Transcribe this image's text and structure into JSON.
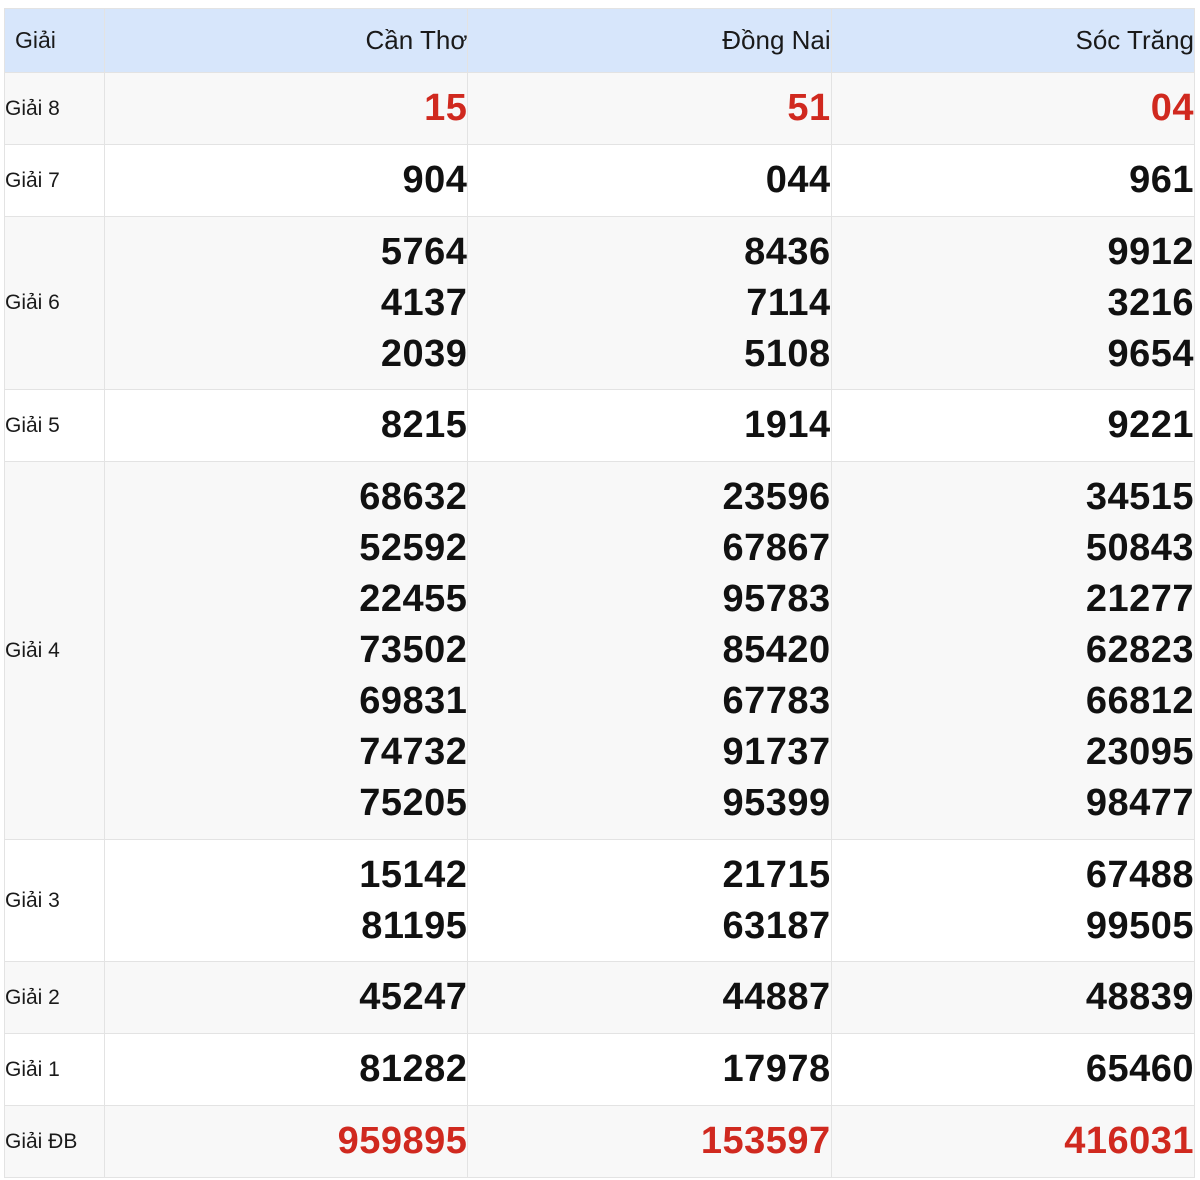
{
  "table": {
    "header": {
      "label": "Giải",
      "provinces": [
        "Cần Thơ",
        "Đồng Nai",
        "Sóc Trăng"
      ]
    },
    "colors": {
      "highlight": "#d0291f",
      "header_bg": "#d7e6fb",
      "text": "#111111"
    },
    "rows": [
      {
        "label": "Giải 8",
        "values": [
          [
            "15"
          ],
          [
            "51"
          ],
          [
            "04"
          ]
        ]
      },
      {
        "label": "Giải 7",
        "values": [
          [
            "904"
          ],
          [
            "044"
          ],
          [
            "961"
          ]
        ]
      },
      {
        "label": "Giải 6",
        "values": [
          [
            "5764",
            "4137",
            "2039"
          ],
          [
            "8436",
            "7114",
            "5108"
          ],
          [
            "9912",
            "3216",
            "9654"
          ]
        ]
      },
      {
        "label": "Giải 5",
        "values": [
          [
            "8215"
          ],
          [
            "1914"
          ],
          [
            "9221"
          ]
        ]
      },
      {
        "label": "Giải 4",
        "values": [
          [
            "68632",
            "52592",
            "22455",
            "73502",
            "69831",
            "74732",
            "75205"
          ],
          [
            "23596",
            "67867",
            "95783",
            "85420",
            "67783",
            "91737",
            "95399"
          ],
          [
            "34515",
            "50843",
            "21277",
            "62823",
            "66812",
            "23095",
            "98477"
          ]
        ]
      },
      {
        "label": "Giải 3",
        "values": [
          [
            "15142",
            "81195"
          ],
          [
            "21715",
            "63187"
          ],
          [
            "67488",
            "99505"
          ]
        ]
      },
      {
        "label": "Giải 2",
        "values": [
          [
            "45247"
          ],
          [
            "44887"
          ],
          [
            "48839"
          ]
        ]
      },
      {
        "label": "Giải 1",
        "values": [
          [
            "81282"
          ],
          [
            "17978"
          ],
          [
            "65460"
          ]
        ]
      },
      {
        "label": "Giải ĐB",
        "values": [
          [
            "959895"
          ],
          [
            "153597"
          ],
          [
            "416031"
          ]
        ]
      }
    ]
  }
}
